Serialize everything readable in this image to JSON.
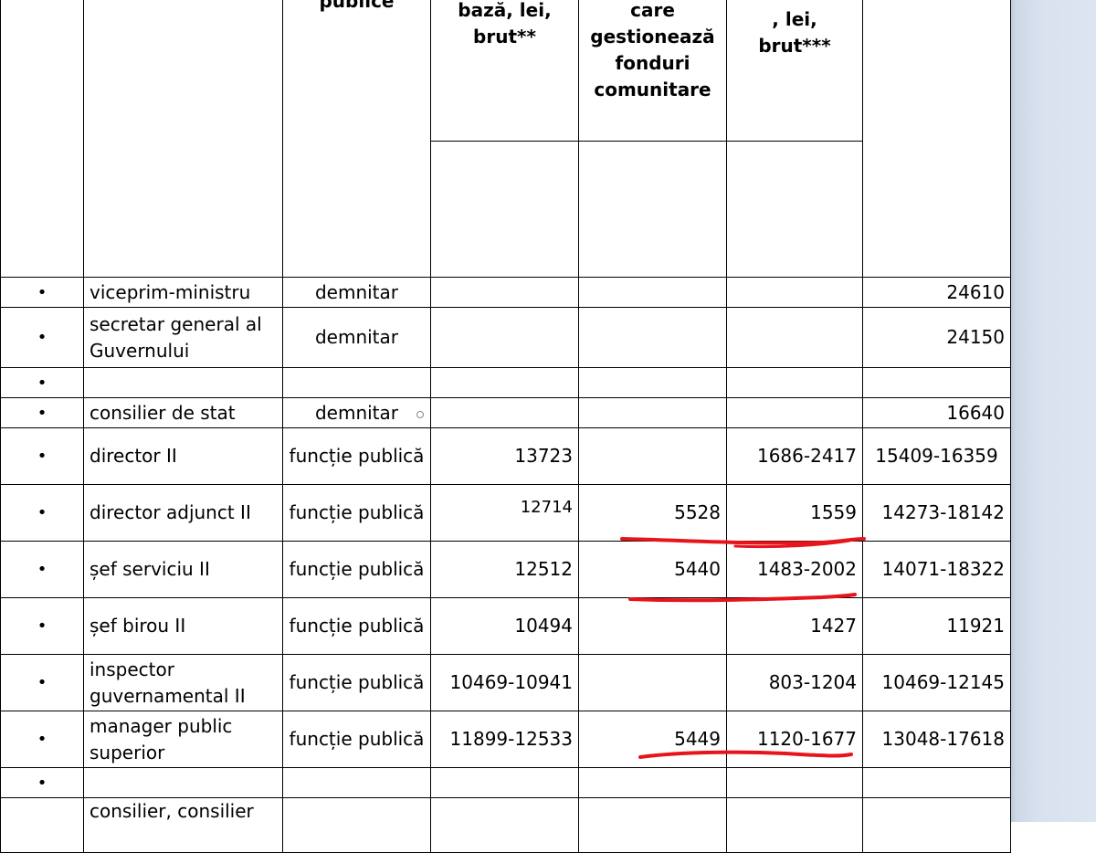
{
  "header": {
    "col_category": "publice",
    "col_base": [
      "bază, lei,",
      "brut**"
    ],
    "col_funds": [
      "care",
      "gestionează",
      "fonduri",
      "comunitare"
    ],
    "col_bonus": [
      ", lei,",
      "brut***"
    ]
  },
  "bullet": "•",
  "rows": [
    {
      "name": "viceprim-ministru",
      "category": "demnitar",
      "base": "",
      "funds": "",
      "bonus": "",
      "total": "24610"
    },
    {
      "name": "secretar general al Guvernului",
      "category": "demnitar",
      "base": "",
      "funds": "",
      "bonus": "",
      "total": "24150"
    },
    {
      "name": "",
      "category": "",
      "base": "",
      "funds": "",
      "bonus": "",
      "total": ""
    },
    {
      "name": "consilier de stat",
      "category": "demnitar",
      "base": "",
      "funds": "",
      "bonus": "",
      "total": "16640"
    },
    {
      "name": "director  II",
      "category": "funcție publică",
      "base": "13723",
      "funds": "",
      "bonus": "1686-2417",
      "total": "15409-16359"
    },
    {
      "name": "director  adjunct  II",
      "category": "funcție publică",
      "base": "12714",
      "funds": "5528",
      "bonus": "1559",
      "total": "14273-18142"
    },
    {
      "name": "șef serviciu II",
      "category": "funcție publică",
      "base": "12512",
      "funds": "5440",
      "bonus": "1483-2002",
      "total": "14071-18322"
    },
    {
      "name": "șef birou  II",
      "category": "funcție publică",
      "base": "10494",
      "funds": "",
      "bonus": "1427",
      "total": "11921"
    },
    {
      "name": "inspector guvernamental  II",
      "category": "funcție publică",
      "base": "10469-10941",
      "funds": "",
      "bonus": "803-1204",
      "total": "10469-12145"
    },
    {
      "name": "manager public superior",
      "category": "funcție publică",
      "base": "11899-12533",
      "funds": "5449",
      "bonus": "1120-1677",
      "total": "13048-17618"
    },
    {
      "name": "",
      "category": "",
      "base": "",
      "funds": "",
      "bonus": "",
      "total": ""
    },
    {
      "name": "consilier, consilier",
      "category": "",
      "base": "",
      "funds": "",
      "bonus": "",
      "total": ""
    }
  ],
  "colors": {
    "annotation": "#e8141c",
    "side_panel": "#d8e1ee"
  }
}
